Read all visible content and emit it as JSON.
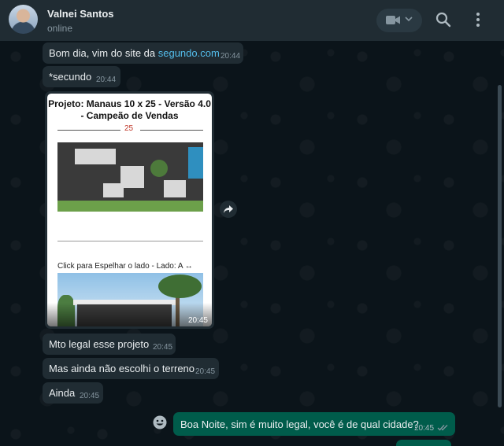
{
  "header": {
    "contact_name": "Valnei Santos",
    "contact_status": "online",
    "icons": [
      "avatar",
      "video-call-icon",
      "chevron-down-icon",
      "search-icon",
      "menu-icon"
    ]
  },
  "messages": [
    {
      "text_prefix": "Bom dia, vim do site da ",
      "link": "segundo.com",
      "time": "20:44",
      "direction": "in"
    },
    {
      "text": "*secundo",
      "time": "20:44",
      "direction": "in"
    },
    {
      "type": "image",
      "time": "20:45",
      "direction": "in",
      "image_title": "Projeto: Manaus 10 x 25 - Versão 4.0 - Campeão de Vendas",
      "dimension_label": "25",
      "mirror_label": "Click para Espelhar o lado - Lado: A",
      "mirror_icon": "↔"
    },
    {
      "text": "Mto legal esse projeto",
      "time": "20:45",
      "direction": "in"
    },
    {
      "text": "Mas ainda não escolhi o terreno",
      "time": "20:45",
      "direction": "in"
    },
    {
      "text": "Ainda",
      "time": "20:45",
      "direction": "in"
    },
    {
      "text": "Boa Noite, sim é muito legal, você é de qual cidade?",
      "time": "20:45",
      "direction": "out",
      "status": "read"
    }
  ],
  "colors": {
    "chat_background": "#0b141a",
    "header": "#202c33",
    "incoming_bubble": "#202c33",
    "outgoing_bubble": "#005c4b",
    "link": "#53bdeb",
    "read_ticks": "#8696a0"
  }
}
